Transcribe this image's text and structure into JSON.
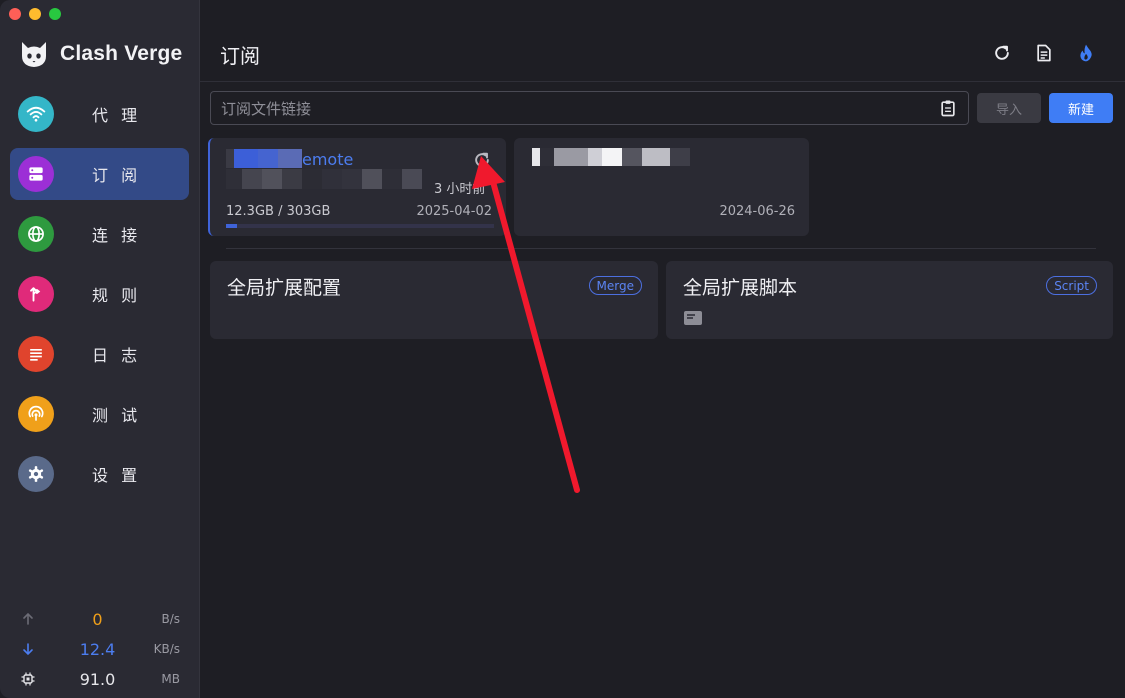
{
  "app": {
    "name": "Clash Verge"
  },
  "nav": [
    {
      "label": "代 理",
      "icon": "wifi-icon",
      "color": "#34b6c8"
    },
    {
      "label": "订 阅",
      "icon": "server-icon",
      "color": "#9c2fd6",
      "active": true
    },
    {
      "label": "连 接",
      "icon": "globe-icon",
      "color": "#2e9a3f"
    },
    {
      "label": "规 则",
      "icon": "fork-icon",
      "color": "#e02a7a"
    },
    {
      "label": "日 志",
      "icon": "list-icon",
      "color": "#e0442d"
    },
    {
      "label": "测 试",
      "icon": "radar-icon",
      "color": "#f0a01a"
    },
    {
      "label": "设 置",
      "icon": "gear-icon",
      "color": "#5a6a8a"
    }
  ],
  "stats": {
    "upload": {
      "value": "0",
      "unit": "B/s",
      "color": "#f0a01a"
    },
    "download": {
      "value": "12.4",
      "unit": "KB/s",
      "color": "#4c7df0"
    },
    "memory": {
      "value": "91.0",
      "unit": "MB",
      "color": "#e6e6ea"
    }
  },
  "header": {
    "title": "订阅",
    "icons": [
      "refresh-icon",
      "document-icon",
      "flame-icon"
    ]
  },
  "subscription_input": {
    "placeholder": "订阅文件链接",
    "import_label": "导入",
    "new_label": "新建"
  },
  "profiles": [
    {
      "name_visible": "emote",
      "updated": "3 小时前",
      "usage": "12.3GB / 303GB",
      "expire": "2025-04-02",
      "usage_fraction": 0.04,
      "selected": true
    },
    {
      "expire": "2024-06-26"
    }
  ],
  "extensions": [
    {
      "title": "全局扩展配置",
      "tag": "Merge"
    },
    {
      "title": "全局扩展脚本",
      "tag": "Script"
    }
  ],
  "colors": {
    "accent": "#3f7df5",
    "annotation_arrow": "#f0192d"
  }
}
